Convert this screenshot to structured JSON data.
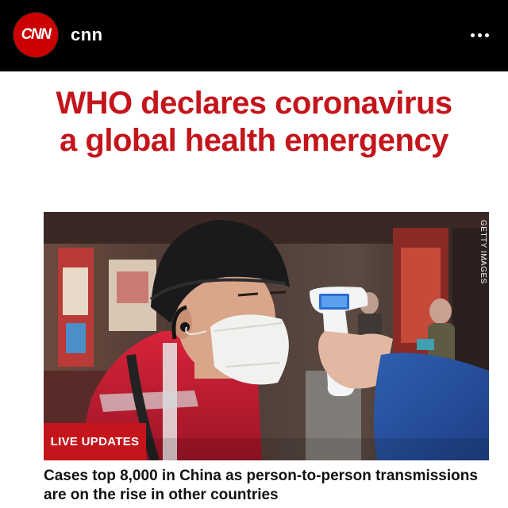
{
  "header": {
    "avatar_text": "CNN",
    "account_name": "cnn"
  },
  "post": {
    "headline": "WHO declares coronavirus a global health emergency",
    "photo_credit": "GETTY IMAGES",
    "badge": "LIVE UPDATES",
    "subheadline": "Cases top 8,000 in China as person-to-person transmissions are on the rise in other countries"
  },
  "colors": {
    "brand_red": "#c4151c",
    "topbar": "#000000"
  }
}
